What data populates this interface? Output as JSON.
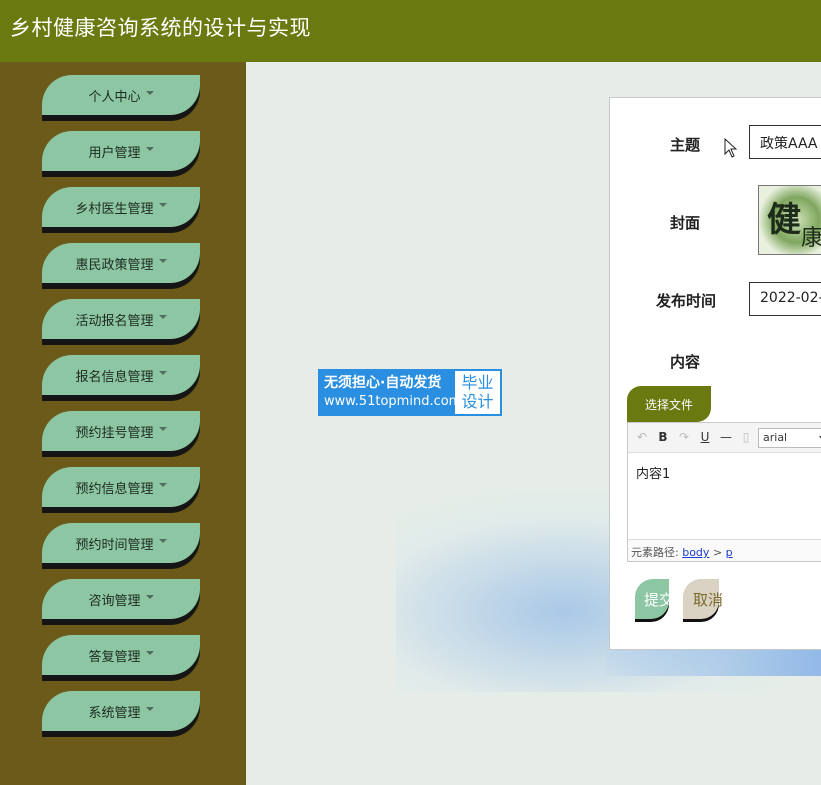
{
  "app": {
    "title": "乡村健康咨询系统的设计与实现"
  },
  "sidebar": {
    "items": [
      {
        "label": "个人中心"
      },
      {
        "label": "用户管理"
      },
      {
        "label": "乡村医生管理"
      },
      {
        "label": "惠民政策管理"
      },
      {
        "label": "活动报名管理"
      },
      {
        "label": "报名信息管理"
      },
      {
        "label": "预约挂号管理"
      },
      {
        "label": "预约信息管理"
      },
      {
        "label": "预约时间管理"
      },
      {
        "label": "咨询管理"
      },
      {
        "label": "答复管理"
      },
      {
        "label": "系统管理"
      }
    ]
  },
  "watermark": {
    "line1": "无须担心·自动发货",
    "line2": "www.51topmind.com",
    "right_top": "毕业",
    "right_bottom": "设计"
  },
  "form": {
    "subject_label": "主题",
    "subject_value": "政策AAA",
    "cover_label": "封面",
    "publish_time_label": "发布时间",
    "publish_time_value": "2022-02-",
    "content_label": "内容",
    "file_button": "选择文件",
    "editor": {
      "bold": "B",
      "underline": "U",
      "hr": "—",
      "font": "arial",
      "content": "内容1",
      "path_label": "元素路径:",
      "path_body": "body",
      "path_sep": ">",
      "path_p": "p"
    },
    "submit_label": "提交",
    "cancel_label": "取消"
  },
  "colors": {
    "topbar": "#6b7a10",
    "sidebar": "#6b5a1a",
    "menu_item": "#8cc6a3",
    "accent_button": "#6b7a10",
    "cancel_button": "#dad2c3"
  }
}
